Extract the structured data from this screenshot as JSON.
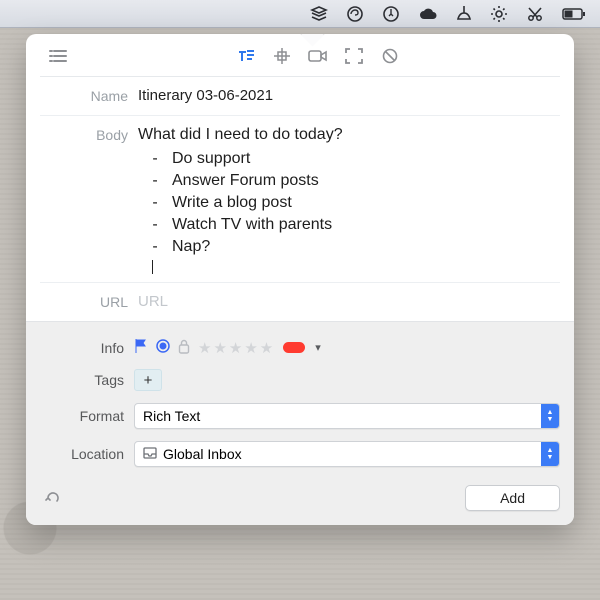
{
  "menubar": {
    "items": [
      "layers-icon",
      "swirl-icon",
      "annotate-icon",
      "cloud-icon",
      "cleaner-icon",
      "gear-icon",
      "scissors-icon",
      "battery-icon"
    ]
  },
  "toolbar": {
    "list": "list-icon",
    "modes": [
      "text-mode-icon",
      "grid-snap-icon",
      "video-icon",
      "fullscreen-icon",
      "block-icon"
    ]
  },
  "name": {
    "label": "Name",
    "value": "Itinerary 03-06-2021"
  },
  "body": {
    "label": "Body",
    "question": "What did I need to do today?",
    "items": [
      "Do support",
      "Answer Forum posts",
      "Write a blog post",
      "Watch TV with parents",
      "Nap?"
    ]
  },
  "url": {
    "label": "URL",
    "placeholder": "URL"
  },
  "info": {
    "label": "Info",
    "flag_color": "#3b68f5",
    "radio_color": "#3b68f5",
    "lock": true,
    "rating": 0,
    "label_color": "#ff3b30"
  },
  "tags": {
    "label": "Tags",
    "add": "+"
  },
  "format": {
    "label": "Format",
    "value": "Rich Text"
  },
  "location": {
    "label": "Location",
    "value": "Global Inbox"
  },
  "footer": {
    "add": "Add"
  }
}
